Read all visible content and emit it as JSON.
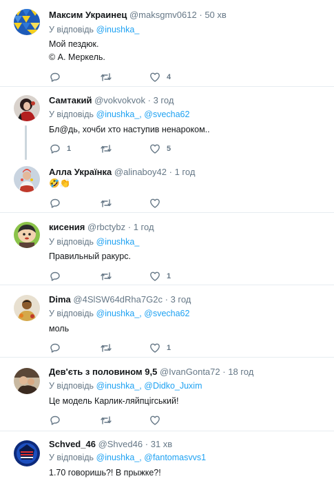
{
  "reply_prefix": "У відповідь",
  "tweets": [
    {
      "name": "Максим Украинец",
      "handle": "@maksgmv0612",
      "time": "50 хв",
      "mentions": [
        "@inushka_"
      ],
      "lines": [
        "Мой пездюк.",
        "© А. Меркель."
      ],
      "likes": "4",
      "replies": "",
      "avatar_colors": [
        "#1e5bb8",
        "#f5d020"
      ]
    },
    {
      "name": "Самтакий",
      "handle": "@vokvokvok",
      "time": "3 год",
      "mentions": [
        "@inushka_,",
        "@svecha62"
      ],
      "lines": [
        "Бл@дь,  хочби хто наступив ненароком.."
      ],
      "likes": "5",
      "replies": "1",
      "avatar_colors": [
        "#2b1b1b",
        "#b32020"
      ]
    },
    {
      "name": "Алла Українка",
      "handle": "@alinaboy42",
      "time": "1 год",
      "mentions": [],
      "lines": [
        "🤣👏"
      ],
      "likes": "",
      "replies": "",
      "avatar_colors": [
        "#c9d4e0",
        "#c0392b"
      ]
    },
    {
      "name": "кисения",
      "handle": "@rbctybz",
      "time": "1 год",
      "mentions": [
        "@inushka_"
      ],
      "lines": [
        "Правильный ракурс."
      ],
      "likes": "1",
      "replies": "",
      "avatar_colors": [
        "#8bc34a",
        "#2d2d2d"
      ]
    },
    {
      "name": "Dima",
      "handle": "@4SlSW64dRha7G2c",
      "time": "3 год",
      "mentions": [
        "@inushka_,",
        "@svecha62"
      ],
      "lines": [
        "моль"
      ],
      "likes": "1",
      "replies": "",
      "avatar_colors": [
        "#e8e0d0",
        "#8a5a2b"
      ]
    },
    {
      "name": "Дев'єть з половином 9,5",
      "handle": "@IvanGonta72",
      "time": "18 год",
      "mentions": [
        "@inushka_,",
        "@Didko_Juxim"
      ],
      "lines": [
        "Це модель Карлик-ляйпцігський!"
      ],
      "likes": "",
      "replies": "",
      "avatar_colors": [
        "#5a4636",
        "#c8b8a0"
      ]
    },
    {
      "name": "Schved_46",
      "handle": "@Shved46",
      "time": "31 хв",
      "mentions": [
        "@inushka_,",
        "@fantomasvvs1"
      ],
      "lines": [
        "1.70 говоришь?! В прыжке?!"
      ],
      "likes": "",
      "replies": "",
      "avatar_colors": [
        "#0d2a7a",
        "#e03030"
      ]
    }
  ]
}
